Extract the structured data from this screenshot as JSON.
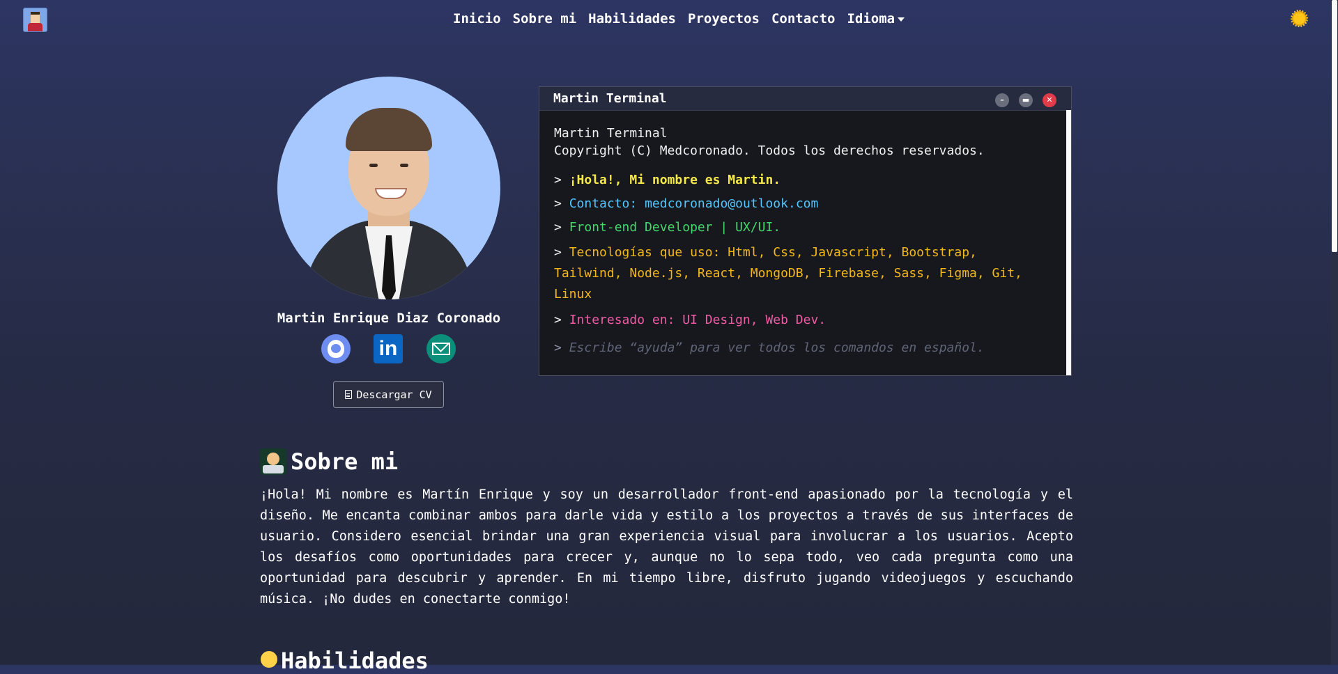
{
  "nav": {
    "items": [
      "Inicio",
      "Sobre mi",
      "Habilidades",
      "Proyectos",
      "Contacto",
      "Idioma"
    ]
  },
  "profile": {
    "name": "Martin Enrique Diaz Coronado",
    "cv_label": "Descargar CV",
    "social": [
      "github-icon",
      "linkedin-icon",
      "mail-icon"
    ],
    "linkedin_glyph": "in"
  },
  "terminal": {
    "title": "Martin Terminal",
    "header_line1": "Martin Terminal",
    "header_line2": "Copyright (C) Medcoronado. Todos los derechos reservados.",
    "prompt": ">",
    "greeting": "¡Hola!, Mi nombre es Martin.",
    "contact_label": "Contacto:",
    "contact_email": "medcoronado@outlook.com",
    "role": "Front-end Developer | UX/UI.",
    "tech": "Tecnologías que uso: Html, Css, Javascript, Bootstrap, Tailwind, Node.js, React, MongoDB, Firebase, Sass, Figma, Git, Linux",
    "interests": "Interesado en: UI Design, Web Dev.",
    "input_placeholder": "Escribe “ayuda” para ver todos los comandos en español.",
    "buttons": {
      "minimize": "–",
      "maximize": "▬",
      "close": "✕"
    }
  },
  "about": {
    "title": "Sobre mi",
    "text": "¡Hola! Mi nombre es Martín Enrique y soy un desarrollador front-end apasionado por la tecnología y el diseño. Me encanta combinar ambos para darle vida y estilo a los proyectos a través de sus interfaces de usuario. Considero esencial brindar una gran experiencia visual para involucrar a los usuarios. Acepto los desafíos como oportunidades para crecer y, aunque no lo sepa todo, veo cada pregunta como una oportunidad para descubrir y aprender. En mi tiempo libre, disfruto jugando videojuegos y escuchando música. ¡No dudes en conectarte conmigo!"
  },
  "skills": {
    "title": "Habilidades"
  },
  "colors": {
    "greeting": "#f5e84a",
    "contact": "#53c5ff",
    "role": "#43d86a",
    "tech": "#f2b81b",
    "interests": "#f05ba5",
    "close_button": "#e03b48"
  }
}
